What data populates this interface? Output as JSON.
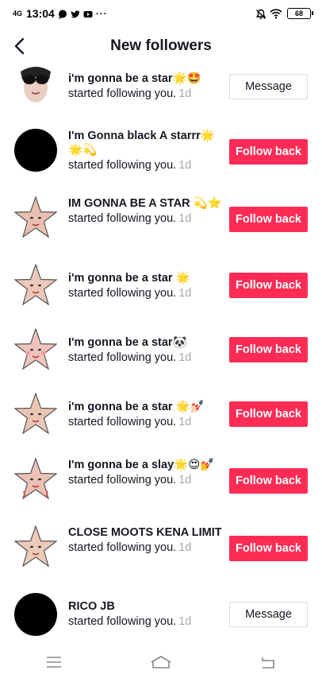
{
  "status_bar": {
    "network": "4G",
    "time": "13:04",
    "dots": "···",
    "battery": "68"
  },
  "header": {
    "title": "New followers"
  },
  "colors": {
    "accent": "#fe2c55",
    "timestamp": "#a8a9ad",
    "text": "#161823"
  },
  "followers": [
    {
      "name": "i'm gonna be a star🌟🤩",
      "action": "started following you.",
      "time": "1d",
      "button": "Message",
      "button_type": "message",
      "avatar": "sunglasses-star-avatar"
    },
    {
      "name": "I'm Gonna black A starrr🌟🌟💫",
      "action": "started following you.",
      "time": "1d",
      "button": "Follow back",
      "button_type": "follow",
      "avatar": "black-circle-avatar"
    },
    {
      "name": "IM GONNA BE A STAR 💫⭐",
      "action": "started following you.",
      "time": "1d",
      "button": "Follow back",
      "button_type": "follow",
      "avatar": "star-face-avatar"
    },
    {
      "name": "i'm gonna be a star 🌟",
      "action": "started following you.",
      "time": "1d",
      "button": "Follow back",
      "button_type": "follow",
      "avatar": "star-face-avatar"
    },
    {
      "name": "I'm gonna be a star🐼",
      "action": "started following you.",
      "time": "1d",
      "button": "Follow back",
      "button_type": "follow",
      "avatar": "star-face-avatar"
    },
    {
      "name": "i'm gonna be a star 🌟💅🏻",
      "action": "started following you.",
      "time": "1d",
      "button": "Follow back",
      "button_type": "follow",
      "avatar": "star-face-avatar"
    },
    {
      "name": "I'm gonna be a slay🌟😍💅",
      "action": "started following you.",
      "time": "1d",
      "button": "Follow back",
      "button_type": "follow",
      "avatar": "star-face-avatar"
    },
    {
      "name": "CLOSE MOOTS KENA LIMIT",
      "action": "started following you.",
      "time": "1d",
      "button": "Follow back",
      "button_type": "follow",
      "avatar": "star-face-avatar"
    },
    {
      "name": "RICO JB",
      "action": "started following you.",
      "time": "1d",
      "button": "Message",
      "button_type": "message",
      "avatar": "black-circle-avatar"
    }
  ]
}
